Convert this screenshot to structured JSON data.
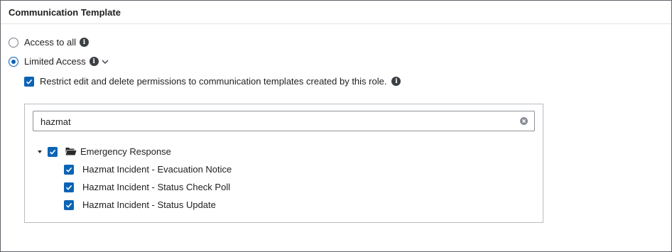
{
  "section": {
    "title": "Communication Template"
  },
  "access": {
    "options": [
      {
        "label": "Access to all",
        "selected": false
      },
      {
        "label": "Limited Access",
        "selected": true
      }
    ],
    "restrict": {
      "label": "Restrict edit and delete permissions to communication templates created by this role.",
      "checked": true
    }
  },
  "tree": {
    "search": {
      "value": "hazmat"
    },
    "folder": {
      "label": "Emergency Response",
      "expanded": true,
      "checked": true,
      "items": [
        {
          "label": "Hazmat Incident - Evacuation Notice",
          "checked": true
        },
        {
          "label": "Hazmat Incident - Status Check Poll",
          "checked": true
        },
        {
          "label": "Hazmat Incident - Status Update",
          "checked": true
        }
      ]
    }
  },
  "colors": {
    "accent": "#0b63b5",
    "border": "#b7bcc2",
    "icon": "#3c3f44"
  },
  "icons": [
    "info-icon",
    "chevron-down-icon",
    "clear-icon",
    "caret-down-icon",
    "folder-open-icon",
    "checkbox-checked-icon"
  ]
}
